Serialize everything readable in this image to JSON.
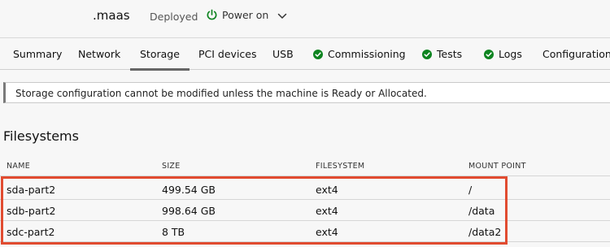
{
  "machine": {
    "hostname": ".maas",
    "status": "Deployed",
    "power_label": "Power on",
    "power_color": "#0e8420"
  },
  "tabs": [
    {
      "label": "Summary",
      "icon": null
    },
    {
      "label": "Network",
      "icon": null
    },
    {
      "label": "Storage",
      "icon": null,
      "active": true
    },
    {
      "label": "PCI devices",
      "icon": null
    },
    {
      "label": "USB",
      "icon": null
    },
    {
      "label": "Commissioning",
      "icon": "check-circle-icon"
    },
    {
      "label": "Tests",
      "icon": "check-circle-icon"
    },
    {
      "label": "Logs",
      "icon": "check-circle-icon"
    },
    {
      "label": "Configuration",
      "icon": null
    }
  ],
  "notice": {
    "text": "Storage configuration cannot be modified unless the machine is Ready or Allocated."
  },
  "filesystems": {
    "title": "Filesystems",
    "columns": [
      "NAME",
      "SIZE",
      "FILESYSTEM",
      "MOUNT POINT"
    ],
    "rows": [
      {
        "name": "sda-part2",
        "size": "499.54 GB",
        "filesystem": "ext4",
        "mount_point": "/"
      },
      {
        "name": "sdb-part2",
        "size": "998.64 GB",
        "filesystem": "ext4",
        "mount_point": "/data"
      },
      {
        "name": "sdc-part2",
        "size": "8 TB",
        "filesystem": "ext4",
        "mount_point": "/data2"
      }
    ]
  },
  "colors": {
    "success": "#0e8420",
    "highlight": "#e14b30"
  }
}
